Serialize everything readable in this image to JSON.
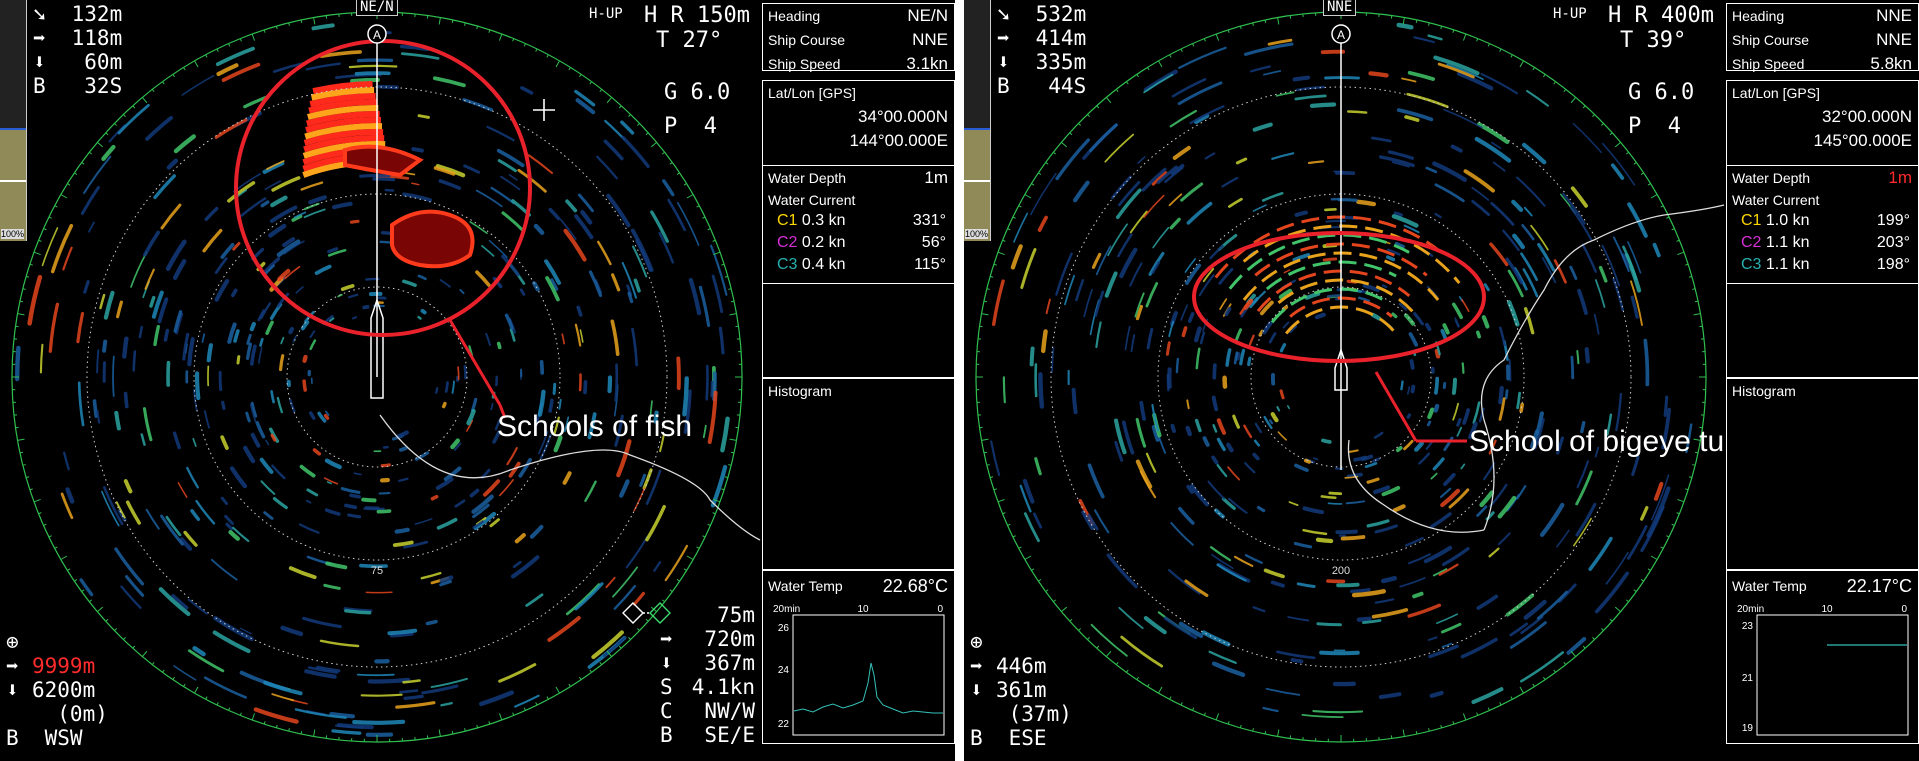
{
  "left": {
    "top_readouts": [
      {
        "icon": "down-right-arrow-icon",
        "glyph": "➘",
        "text": " 132m"
      },
      {
        "icon": "right-arrow-icon",
        "glyph": "➡",
        "text": " 118m"
      },
      {
        "icon": "down-arrow-icon",
        "glyph": "⬇",
        "text": "  60m"
      },
      {
        "icon": "",
        "glyph": "B",
        "text": "  32S"
      }
    ],
    "heading_mark": "NE/N",
    "hup": "H-UP",
    "hr": "H R 150m",
    "tilt": "T 27°",
    "gain": "G 6.0",
    "p": "P  4",
    "range_ring_label": "75",
    "gauge_label": "100%",
    "bottom_left": [
      {
        "icon": "crosshair-icon",
        "glyph": "⊕",
        "text": ""
      },
      {
        "icon": "right-arrow-icon",
        "glyph": "➡",
        "text": "9999m",
        "color": "#ff2b2b"
      },
      {
        "icon": "down-arrow-icon",
        "glyph": "⬇",
        "text": "6200m"
      },
      {
        "icon": "",
        "glyph": "",
        "text": "  (0m)"
      },
      {
        "icon": "",
        "glyph": "B",
        "text": " WSW"
      }
    ],
    "bottom_right": [
      {
        "glyph": "",
        "text": "75m"
      },
      {
        "glyph": "➡",
        "text": "720m"
      },
      {
        "glyph": "⬇",
        "text": "367m"
      },
      {
        "glyph": "S",
        "text": "4.1kn"
      },
      {
        "glyph": "C",
        "text": "NW/W"
      },
      {
        "glyph": "B",
        "text": "SE/E"
      }
    ],
    "panel": {
      "heading_label": "Heading",
      "heading": "NE/N",
      "course_label": "Ship Course",
      "course": "NNE",
      "speed_label": "Ship Speed",
      "speed": "3.1kn",
      "latlon_label": "Lat/Lon [GPS]",
      "lat": "34°00.000N",
      "lon": "144°00.000E",
      "depth_label": "Water Depth",
      "depth": "1m",
      "current_label": "Water Current",
      "currents": [
        {
          "name": "C1",
          "speed": "0.3 kn",
          "dir": "331°",
          "color": "#ffd700"
        },
        {
          "name": "C2",
          "speed": "0.2 kn",
          "dir": " 56°",
          "color": "#d62fd6"
        },
        {
          "name": "C3",
          "speed": "0.4 kn",
          "dir": "115°",
          "color": "#28b0b0"
        }
      ],
      "histogram_label": "Histogram",
      "temp_label": "Water Temp",
      "temp": "22.68°C",
      "temp_axis": [
        "20min",
        "10",
        "0"
      ],
      "temp_ticks": [
        "26",
        "24",
        "22"
      ]
    },
    "callout": "Schools of fish",
    "colors": {
      "circle": "#e8212b",
      "ring_green": "#2fbf4f"
    }
  },
  "right": {
    "top_readouts": [
      {
        "icon": "down-right-arrow-icon",
        "glyph": "➘",
        "text": " 532m"
      },
      {
        "icon": "right-arrow-icon",
        "glyph": "➡",
        "text": " 414m"
      },
      {
        "icon": "down-arrow-icon",
        "glyph": "⬇",
        "text": " 335m"
      },
      {
        "icon": "",
        "glyph": "B",
        "text": "  44S"
      }
    ],
    "heading_mark": "NNE",
    "hup": "H-UP",
    "hr": "H R 400m",
    "tilt": "T 39°",
    "gain": "G 6.0",
    "p": "P  4",
    "range_ring_label": "200",
    "gauge_label": "100%",
    "bottom_left": [
      {
        "icon": "crosshair-icon",
        "glyph": "⊕",
        "text": ""
      },
      {
        "icon": "right-arrow-icon",
        "glyph": "➡",
        "text": "446m"
      },
      {
        "icon": "down-arrow-icon",
        "glyph": "⬇",
        "text": "361m"
      },
      {
        "icon": "",
        "glyph": "",
        "text": " (37m)"
      },
      {
        "icon": "",
        "glyph": "B",
        "text": " ESE"
      }
    ],
    "panel": {
      "heading_label": "Heading",
      "heading": "NNE",
      "course_label": "Ship Course",
      "course": "NNE",
      "speed_label": "Ship Speed",
      "speed": "5.8kn",
      "latlon_label": "Lat/Lon [GPS]",
      "lat": "32°00.000N",
      "lon": "145°00.000E",
      "depth_label": "Water Depth",
      "depth": "1m",
      "current_label": "Water Current",
      "currents": [
        {
          "name": "C1",
          "speed": "1.0 kn",
          "dir": "199°",
          "color": "#ffd700"
        },
        {
          "name": "C2",
          "speed": "1.1 kn",
          "dir": "203°",
          "color": "#d62fd6"
        },
        {
          "name": "C3",
          "speed": "1.1 kn",
          "dir": "198°",
          "color": "#28b0b0"
        }
      ],
      "histogram_label": "Histogram",
      "temp_label": "Water Temp",
      "temp": "22.17°C",
      "temp_axis": [
        "20min",
        "10",
        "0"
      ],
      "temp_ticks": [
        "23",
        "21",
        "19"
      ]
    },
    "callout": "School of bigeye tuna",
    "colors": {
      "circle": "#e8212b",
      "ring_green": "#2fbf4f"
    }
  }
}
